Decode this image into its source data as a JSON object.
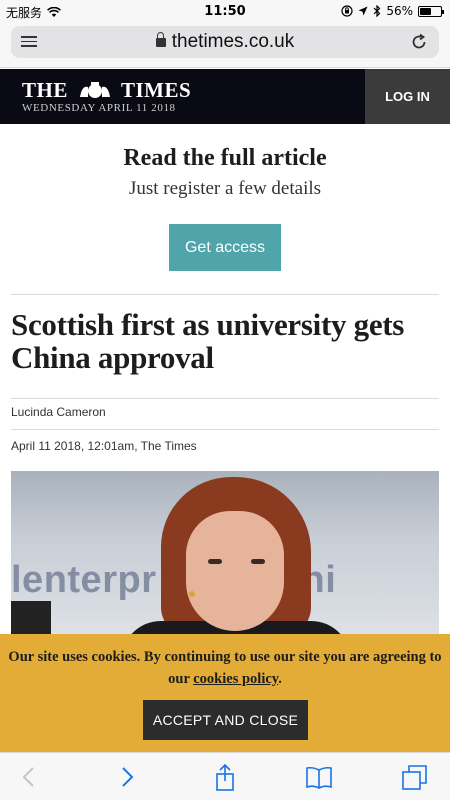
{
  "status_bar": {
    "carrier": "无服务",
    "time": "11:50",
    "battery": "56%",
    "battery_level": 0.56
  },
  "browser": {
    "url": "thetimes.co.uk"
  },
  "header": {
    "masthead_left": "THE",
    "masthead_right": "TIMES",
    "date": "WEDNESDAY APRIL 11 2018",
    "login_label": "LOG IN"
  },
  "promo": {
    "title": "Read the full article",
    "subtitle": "Just register a few details",
    "cta_label": "Get access",
    "cta_color": "#4fa5aa"
  },
  "article": {
    "headline": "Scottish first as university gets China approval",
    "author": "Lucinda Cameron",
    "timestamp": "April 11 2018, 12:01am, The Times",
    "image_text": "lenterpr   demy/chi"
  },
  "cookie_banner": {
    "text_before": "Our site uses cookies. By continuing to use our site you are agreeing to our",
    "link": "cookies policy",
    "text_after": ".",
    "button_label": "ACCEPT AND CLOSE",
    "background": "#e3ac36"
  },
  "toolbar": {
    "icons": [
      "back-icon",
      "forward-icon",
      "share-icon",
      "bookmarks-icon",
      "tabs-icon"
    ]
  }
}
